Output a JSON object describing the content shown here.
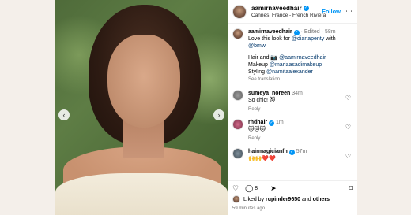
{
  "post": {
    "username": "aamirnaveedhair",
    "location": "Cannes, France - French Riviera",
    "follow_label": "Follow",
    "more_icon": "more-icon"
  },
  "caption": {
    "username": "aamirnaveedhair",
    "edited": "Edited",
    "time": "58m",
    "line1": "Love this look for",
    "mention1": "@dianapenty",
    "with": "with",
    "mention2": "@bmw",
    "hair_label": "Hair and 📷",
    "mention3": "@aamirnaveedhair",
    "makeup_label": "Makeup",
    "mention4": "@mariaasadimakeup",
    "styling_label": "Styling",
    "mention5": "@namitaalexander",
    "see_translation": "See translation"
  },
  "comments": [
    {
      "username": "sumeya_noreen",
      "time": "34m",
      "text": "So chic! 😻",
      "reply": "Reply"
    },
    {
      "username": "rhdhair",
      "time": "1m",
      "text": "😻😻😻",
      "reply": "Reply"
    },
    {
      "username": "hairmagicianfh",
      "time": "57m",
      "text": "🙌🙌❤️❤️"
    }
  ],
  "actions": {
    "comment_count": "8",
    "liked_prefix": "Liked by",
    "liked_user": "rupinder9650",
    "liked_and": "and",
    "liked_others": "others",
    "time_ago": "59 minutes ago"
  },
  "colors": {
    "accent": "#0095f6",
    "mention": "#00376b",
    "muted": "#737373"
  }
}
